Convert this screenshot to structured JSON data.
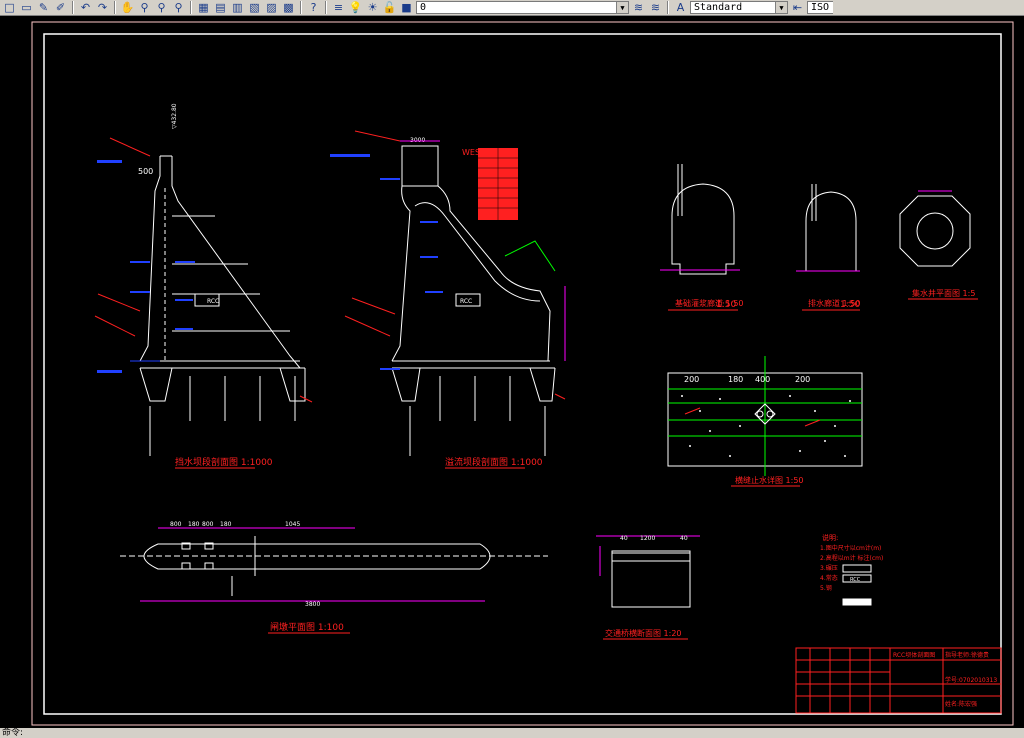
{
  "toolbar": {
    "layer_name": "0",
    "text_style": "Standard",
    "dimstyle_label": "ISO"
  },
  "labels": {
    "sec1_title": "挡水坝段剖面图  1:1000",
    "sec2_title": "溢流坝段剖面图  1:1000",
    "gallery1_title": "基础灌浆廊道  1:50",
    "gallery2_title": "排水廊道  1:50",
    "well_title": "集水井平面图  1:5",
    "joint_title": "横缝止水详图  1:50",
    "pier_title": "闸墩平面图  1:100",
    "bridge_title": "交通桥横断面图  1:20",
    "rcc_label": "RCC",
    "rcc_label2": "RCC",
    "wes_label": "WES",
    "dim_500": "500",
    "dim_3000": "3000",
    "elev_top": "▽432.80",
    "dim_1200": "1200",
    "dim_40a": "40",
    "dim_40b": "40",
    "joint_dims": [
      "200",
      "180",
      "400",
      "200"
    ],
    "pier_dims": [
      "800",
      "180",
      "800",
      "180"
    ],
    "dim_1045": "1045",
    "dim_3800": "3800",
    "scale_150a": "1:50",
    "scale_150b": "1:50",
    "notes_title": "说明:",
    "notes": [
      "1.图中尺寸以cm计(m)",
      "2.高程以m计 标注(cm)",
      "3.碾压",
      "4.常态",
      "5.钢"
    ],
    "legend_rcc": "RCC",
    "title_block": {
      "drawing_name": "RCC坝体剖面图",
      "teacher": "指导老师:徐德贵",
      "student_id": "学号:0702010313",
      "student_name": "姓名:陈宏强"
    }
  },
  "status": {
    "command": "命令:"
  },
  "colors": {
    "background": "#000000",
    "toolbar": "#d4d0c8",
    "geometry": "#ffffff",
    "annotation_red": "#ff2020",
    "annotation_blue": "#2040ff",
    "dimension_magenta": "#ff00ff",
    "joint_green": "#00ff00",
    "frame": "#ffc8c8"
  }
}
